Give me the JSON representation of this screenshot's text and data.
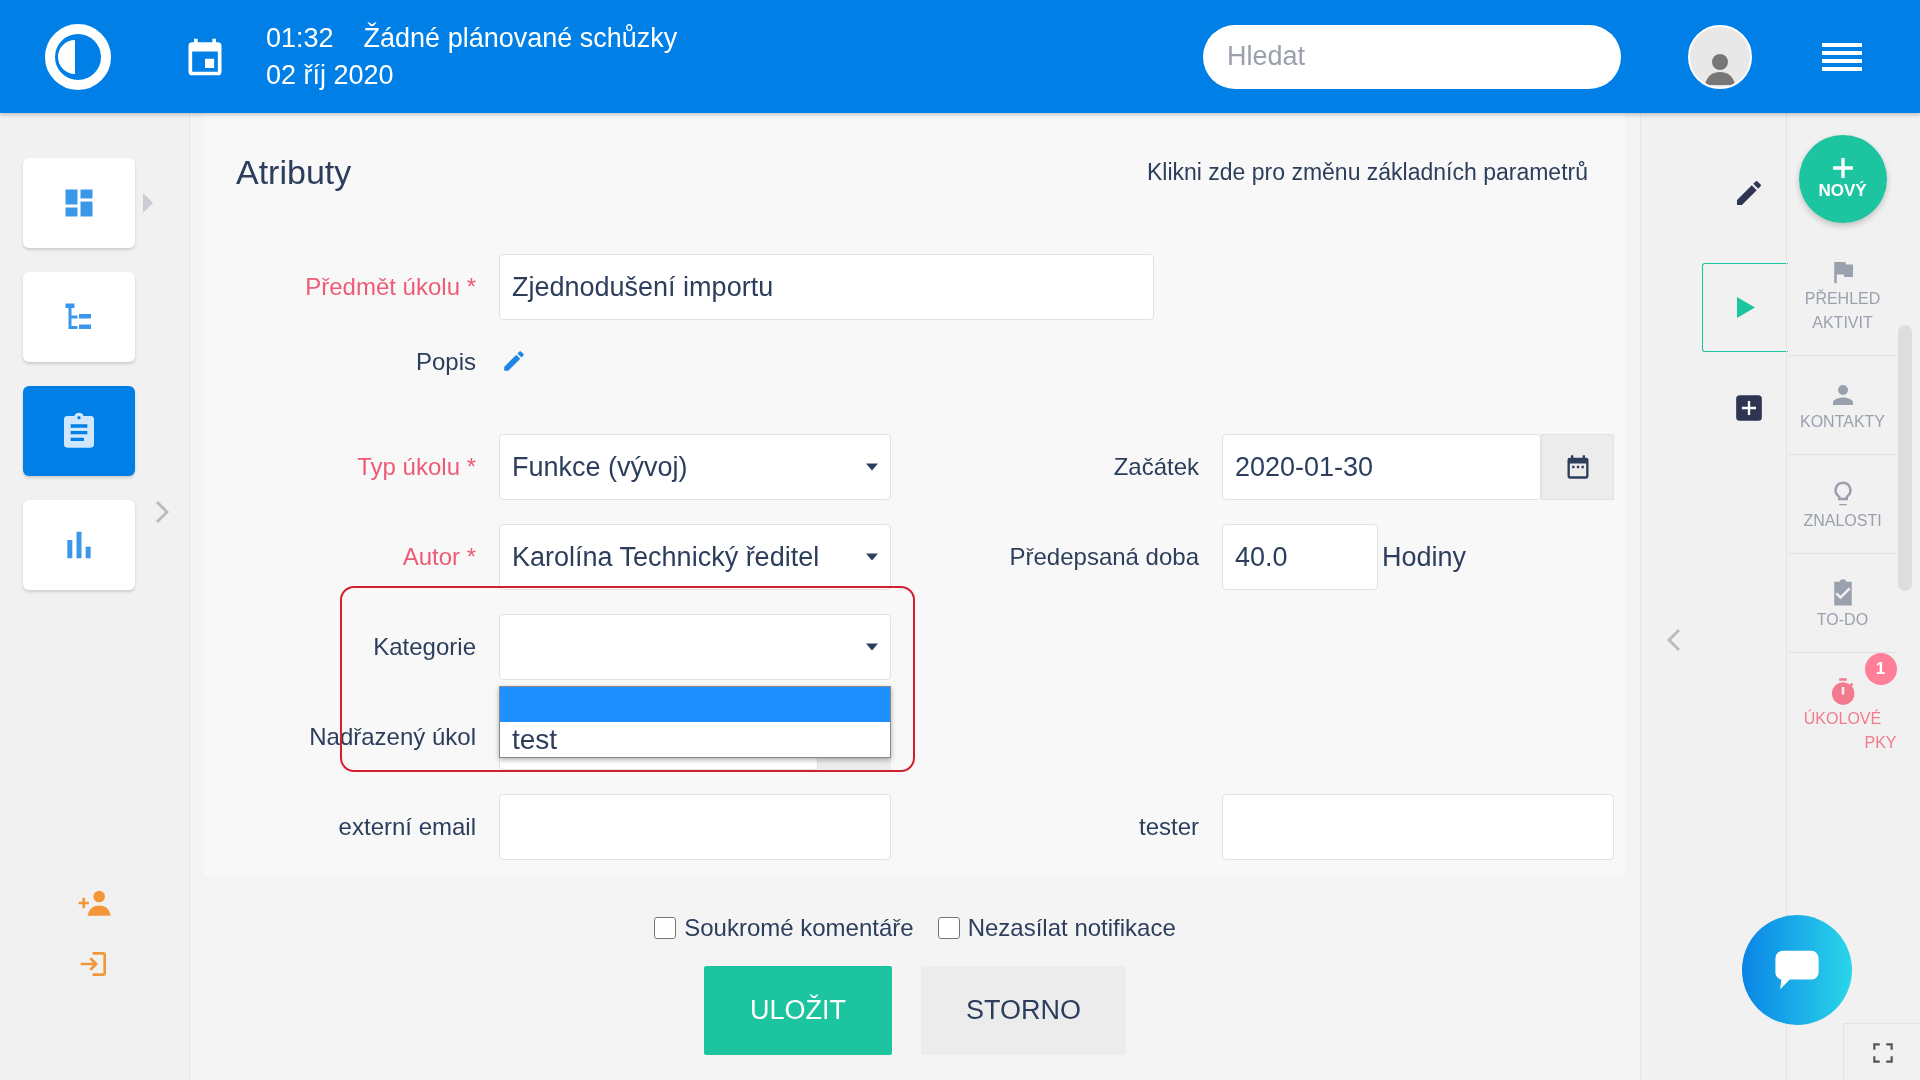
{
  "header": {
    "time": "01:32",
    "meetings": "Žádné plánované schůzky",
    "date": "02 říj 2020",
    "search": {
      "placeholder": "Hledat"
    }
  },
  "left_nav": {
    "items": [
      {
        "kind": "dashboard",
        "selected": false,
        "expandable": true
      },
      {
        "kind": "tree",
        "selected": false,
        "expandable": false
      },
      {
        "kind": "clipboard",
        "selected": true,
        "expandable": false
      },
      {
        "kind": "chart",
        "selected": false,
        "expandable": false
      }
    ]
  },
  "form": {
    "title": "Atributy",
    "link": "Klikni zde pro změnu základních parametrů",
    "rows": [
      {
        "left": {
          "label": "Předmět úkolu *",
          "required": true,
          "kind": "text",
          "value": "Zjednodušení importu"
        }
      },
      {
        "left": {
          "label": "Popis",
          "required": false,
          "kind": "editor"
        }
      },
      {
        "left": {
          "label": "Typ úkolu *",
          "required": true,
          "kind": "select",
          "value": "Funkce (vývoj)"
        },
        "right": {
          "label": "Začátek",
          "required": false,
          "kind": "date",
          "value": "2020-01-30"
        }
      },
      {
        "left": {
          "label": "Autor *",
          "required": true,
          "kind": "select",
          "value": "Karolína Technický ředitel"
        },
        "right": {
          "label": "Předepsaná doba",
          "required": false,
          "kind": "hours",
          "value": "40.0",
          "unit": "Hodiny"
        }
      },
      {
        "left": {
          "label": "Kategorie",
          "required": false,
          "kind": "select",
          "open": true,
          "options": [
            {
              "selected": true
            },
            {
              "label": "test",
              "selected": false
            }
          ]
        }
      },
      {
        "left": {
          "label": "Nadřazený úkol",
          "required": false,
          "kind": "lookup"
        }
      },
      {
        "left": {
          "label": "externí email",
          "required": false,
          "kind": "text"
        },
        "right": {
          "label": "tester",
          "required": false,
          "kind": "text"
        }
      }
    ]
  },
  "checkboxes": [
    {
      "label": "Soukromé komentáře",
      "checked": false
    },
    {
      "label": "Nezasílat notifikace",
      "checked": false
    }
  ],
  "buttons": [
    {
      "label": "ULOŽIT",
      "kind": "primary"
    },
    {
      "label": "STORNO",
      "kind": "secondary"
    }
  ],
  "right_nav": {
    "new_button": "NOVÝ",
    "items": [
      {
        "kind": "flag",
        "lines": [
          "PŘEHLED",
          "AKTIVIT"
        ],
        "highlighted": false
      },
      {
        "kind": "person",
        "lines": [
          "KONTAKTY"
        ],
        "highlighted": false
      },
      {
        "kind": "bulb",
        "lines": [
          "ZNALOSTI"
        ],
        "highlighted": false
      },
      {
        "kind": "todo",
        "lines": [
          "TO-DO"
        ],
        "highlighted": false
      },
      {
        "kind": "timer",
        "lines": [
          "ÚKOLOVÉ",
          "PKY"
        ],
        "highlighted": true,
        "badge": "1"
      }
    ]
  }
}
